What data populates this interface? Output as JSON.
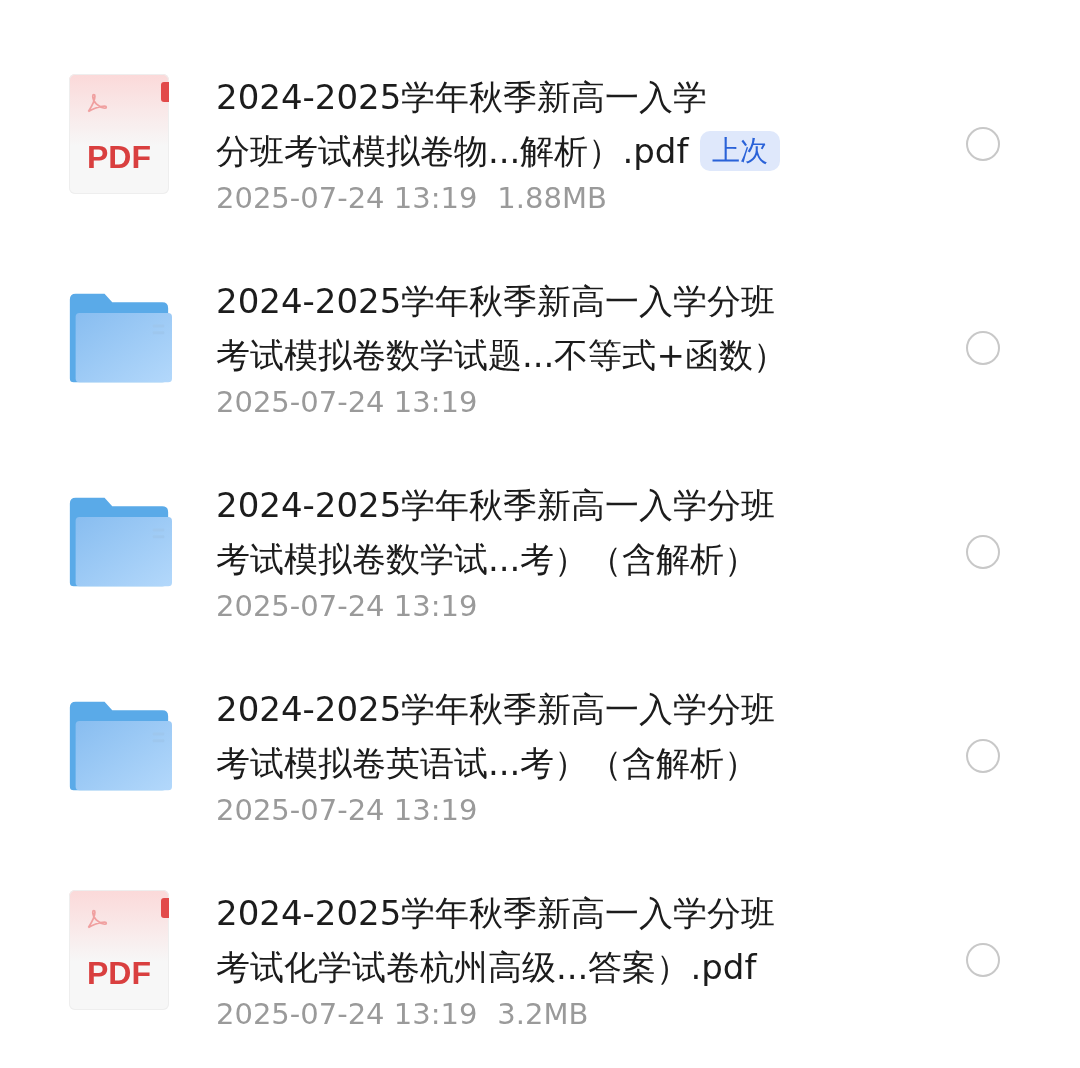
{
  "files": [
    {
      "kind": "pdf",
      "icon_label": "PDF",
      "title_lines": [
        "2024-2025学年秋季新高一入学",
        "分班考试模拟卷物...解析）.pdf"
      ],
      "badge": "上次",
      "date": "2025-07-24 13:19",
      "size": "1.88MB",
      "selected": false
    },
    {
      "kind": "folder",
      "title_lines": [
        "2024-2025学年秋季新高一入学分班",
        "考试模拟卷数学试题...不等式+函数）"
      ],
      "date": "2025-07-24 13:19",
      "selected": false
    },
    {
      "kind": "folder",
      "title_lines": [
        "2024-2025学年秋季新高一入学分班",
        "考试模拟卷数学试...考）（含解析）"
      ],
      "date": "2025-07-24 13:19",
      "selected": false
    },
    {
      "kind": "folder",
      "title_lines": [
        "2024-2025学年秋季新高一入学分班",
        "考试模拟卷英语试...考）（含解析）"
      ],
      "date": "2025-07-24 13:19",
      "selected": false
    },
    {
      "kind": "pdf",
      "icon_label": "PDF",
      "title_lines": [
        "2024-2025学年秋季新高一入学分班",
        "考试化学试卷杭州高级...答案）.pdf"
      ],
      "date": "2025-07-24 13:19",
      "size": "3.2MB",
      "selected": false
    }
  ]
}
